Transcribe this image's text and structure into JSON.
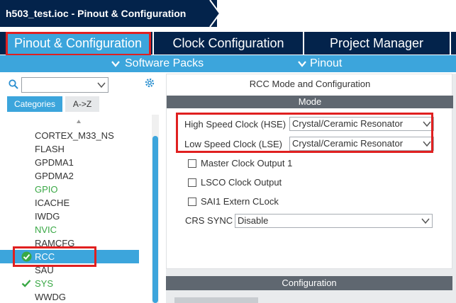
{
  "title": {
    "breadcrumb": "h503_test.ioc - Pinout & Configuration"
  },
  "tabs": [
    {
      "label": "Pinout & Configuration",
      "active": true
    },
    {
      "label": "Clock Configuration",
      "active": false
    },
    {
      "label": "Project Manager",
      "active": false
    }
  ],
  "submenu": {
    "software_packs": "Software Packs",
    "pinout": "Pinout"
  },
  "left": {
    "search": {
      "value": "",
      "placeholder": ""
    },
    "category_tabs": [
      "Categories",
      "A->Z"
    ],
    "items": [
      {
        "label": "CORTEX_M33_NS",
        "status": "none"
      },
      {
        "label": "FLASH",
        "status": "none"
      },
      {
        "label": "GPDMA1",
        "status": "none"
      },
      {
        "label": "GPDMA2",
        "status": "none"
      },
      {
        "label": "GPIO",
        "status": "configured"
      },
      {
        "label": "ICACHE",
        "status": "none"
      },
      {
        "label": "IWDG",
        "status": "none"
      },
      {
        "label": "NVIC",
        "status": "configured"
      },
      {
        "label": "RAMCFG",
        "status": "none"
      },
      {
        "label": "RCC",
        "status": "selected-ok"
      },
      {
        "label": "SAU",
        "status": "none"
      },
      {
        "label": "SYS",
        "status": "ok"
      },
      {
        "label": "WWDG",
        "status": "none"
      }
    ]
  },
  "rcc": {
    "title": "RCC Mode and Configuration",
    "mode_header": "Mode",
    "hse_label": "High Speed Clock (HSE)",
    "hse_value": "Crystal/Ceramic Resonator",
    "lse_label": "Low Speed Clock (LSE)",
    "lse_value": "Crystal/Ceramic Resonator",
    "checkboxes": [
      {
        "label": "Master Clock Output 1",
        "checked": false
      },
      {
        "label": "LSCO Clock Output",
        "checked": false
      },
      {
        "label": "SAI1 Extern CLock",
        "checked": false
      }
    ],
    "crs_label": "CRS SYNC",
    "crs_value": "Disable",
    "config_header": "Configuration"
  },
  "colors": {
    "navy": "#03234b",
    "accent_blue": "#3ca5dc",
    "highlight_red": "#e02020",
    "ok_green": "#39a845"
  }
}
